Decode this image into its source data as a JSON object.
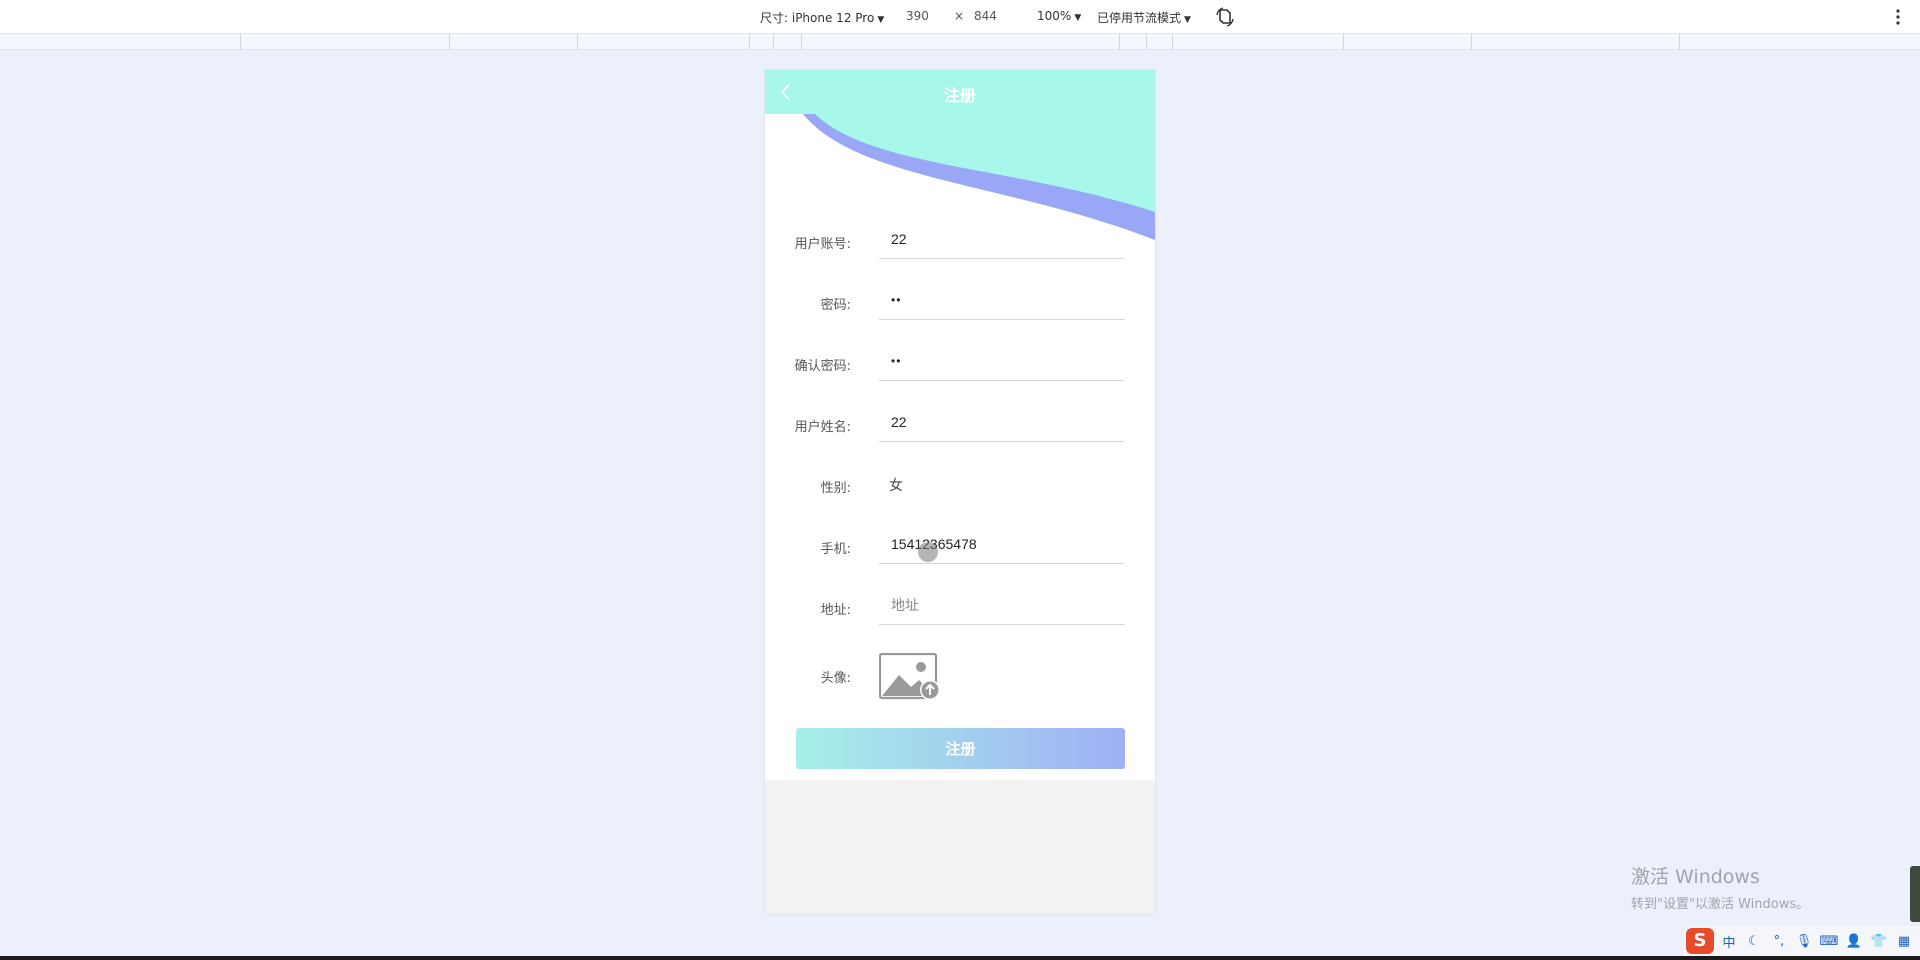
{
  "devtools": {
    "device_label": "尺寸: iPhone 12 Pro",
    "width": "390",
    "times": "×",
    "height": "844",
    "zoom": "100%",
    "throttle": "已停用节流模式"
  },
  "app": {
    "title": "注册",
    "fields": [
      {
        "label": "用户账号:",
        "value": "22",
        "placeholder": "",
        "type": "text"
      },
      {
        "label": "密码:",
        "value": "••",
        "placeholder": "",
        "type": "password"
      },
      {
        "label": "确认密码:",
        "value": "••",
        "placeholder": "",
        "type": "password"
      },
      {
        "label": "用户姓名:",
        "value": "22",
        "placeholder": "",
        "type": "text"
      },
      {
        "label": "性别:",
        "value": "女"
      },
      {
        "label": "手机:",
        "value": "15412365478",
        "placeholder": "",
        "type": "text"
      },
      {
        "label": "地址:",
        "value": "",
        "placeholder": "地址",
        "type": "text"
      },
      {
        "label": "头像:"
      }
    ],
    "register_button": "注册"
  },
  "watermark": {
    "title": "激活 Windows",
    "subtitle": "转到\"设置\"以激活 Windows。"
  },
  "tray": {
    "ime_mode": "中",
    "logo": "S"
  },
  "colors": {
    "header_bg": "#a7f7ea",
    "wave_stripe": "#9aa6f6",
    "button_start": "#a6f0e8",
    "button_end": "#9fb0f5"
  }
}
